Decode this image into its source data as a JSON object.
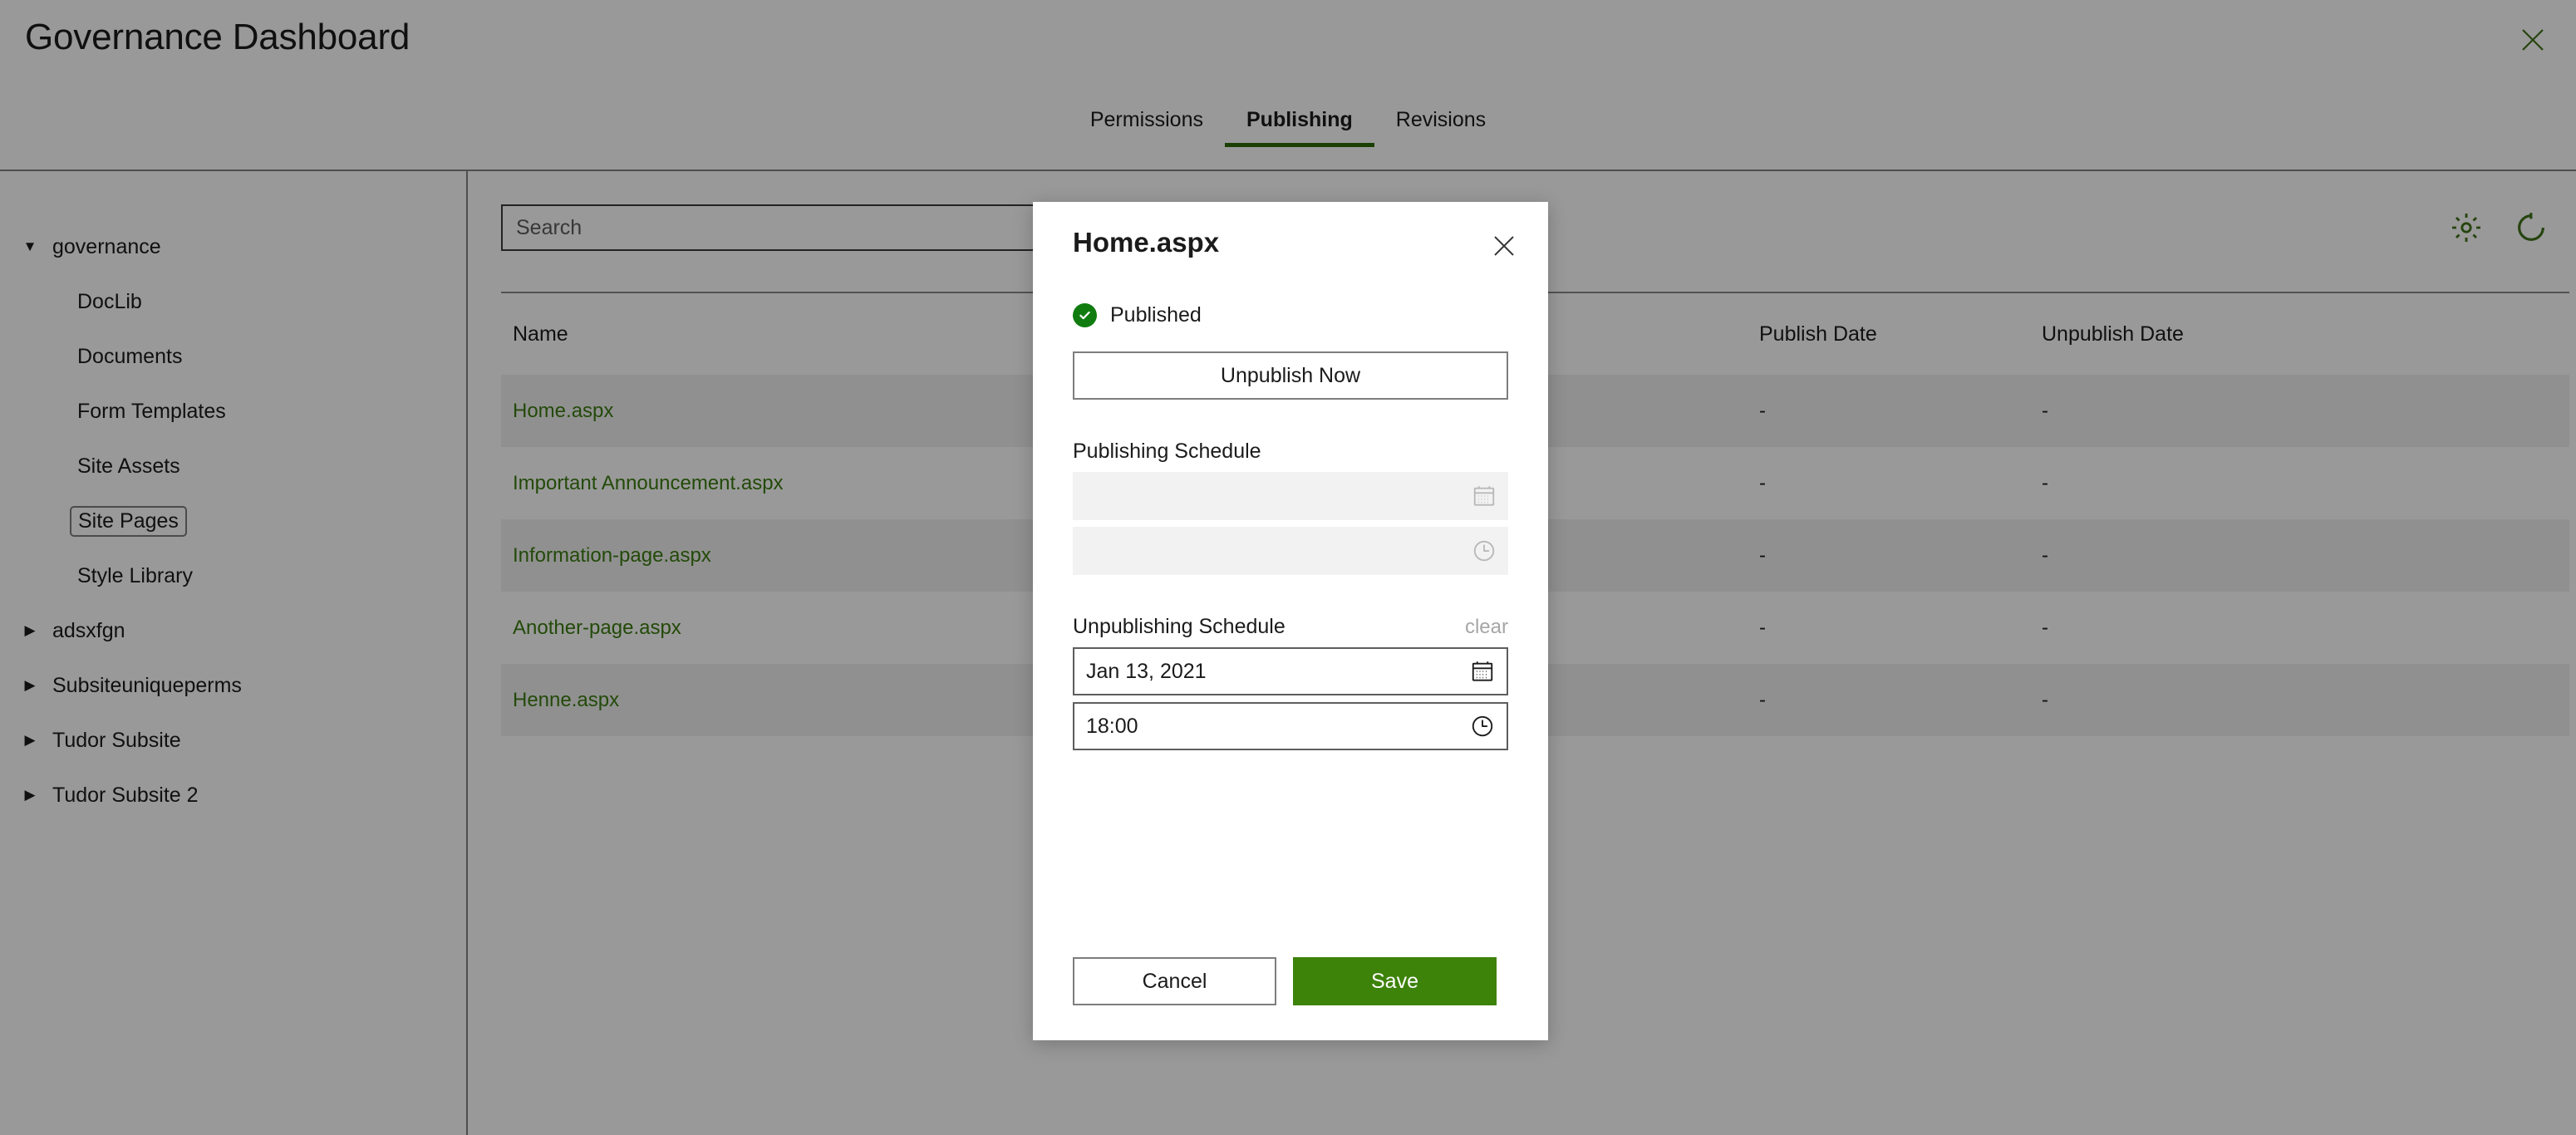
{
  "header": {
    "title": "Governance Dashboard",
    "close_icon": "close-icon"
  },
  "tabs": [
    {
      "label": "Permissions",
      "active": false
    },
    {
      "label": "Publishing",
      "active": true
    },
    {
      "label": "Revisions",
      "active": false
    }
  ],
  "sidebar": {
    "items": [
      {
        "label": "governance",
        "level": 1,
        "twisty": "▼",
        "selected": false
      },
      {
        "label": "DocLib",
        "level": 2,
        "twisty": "",
        "selected": false
      },
      {
        "label": "Documents",
        "level": 2,
        "twisty": "",
        "selected": false
      },
      {
        "label": "Form Templates",
        "level": 2,
        "twisty": "",
        "selected": false
      },
      {
        "label": "Site Assets",
        "level": 2,
        "twisty": "",
        "selected": false
      },
      {
        "label": "Site Pages",
        "level": 2,
        "twisty": "",
        "selected": true
      },
      {
        "label": "Style Library",
        "level": 2,
        "twisty": "",
        "selected": false
      },
      {
        "label": "adsxfgn",
        "level": 1,
        "twisty": "▶",
        "selected": false
      },
      {
        "label": "Subsiteuniqueperms",
        "level": 1,
        "twisty": "▶",
        "selected": false
      },
      {
        "label": "Tudor Subsite",
        "level": 1,
        "twisty": "▶",
        "selected": false
      },
      {
        "label": "Tudor Subsite 2",
        "level": 1,
        "twisty": "▶",
        "selected": false
      }
    ]
  },
  "toolbar": {
    "search_placeholder": "Search",
    "search_value": "",
    "settings_icon": "gear-icon",
    "refresh_icon": "refresh-icon"
  },
  "grid": {
    "columns": [
      "Name",
      "",
      "Publish Date",
      "Unpublish Date"
    ],
    "rows": [
      {
        "name": "Home.aspx",
        "status": "",
        "publish_date": "-",
        "unpublish_date": "-"
      },
      {
        "name": "Important Announcement.aspx",
        "status": "",
        "publish_date": "-",
        "unpublish_date": "-"
      },
      {
        "name": "Information-page.aspx",
        "status": "",
        "publish_date": "-",
        "unpublish_date": "-"
      },
      {
        "name": "Another-page.aspx",
        "status": "",
        "publish_date": "-",
        "unpublish_date": "-"
      },
      {
        "name": "Henne.aspx",
        "status": "",
        "publish_date": "-",
        "unpublish_date": "-"
      }
    ]
  },
  "modal": {
    "title": "Home.aspx",
    "close_icon": "close-icon",
    "status_text": "Published",
    "status_icon": "check-circle-icon",
    "unpublish_now_label": "Unpublish Now",
    "publishing": {
      "group_label": "Publishing Schedule",
      "date_value": "",
      "time_value": "",
      "date_icon": "calendar-icon",
      "time_icon": "clock-icon",
      "enabled": false
    },
    "unpublishing": {
      "group_label": "Unpublishing Schedule",
      "clear_label": "clear",
      "date_value": "Jan 13, 2021",
      "time_value": "18:00",
      "date_icon": "calendar-icon",
      "time_icon": "clock-icon",
      "enabled": true
    },
    "cancel_label": "Cancel",
    "save_label": "Save"
  },
  "colors": {
    "accent_green": "#3d8209",
    "tab_underline": "#2c6a06",
    "link_green": "#3b7c10",
    "status_green": "#107c10"
  }
}
